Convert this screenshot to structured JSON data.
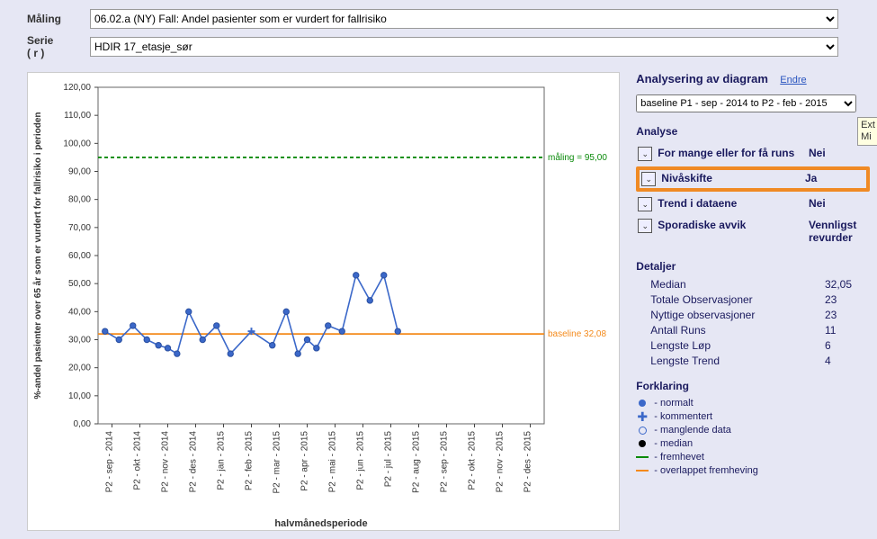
{
  "form": {
    "maling_label": "Måling",
    "maling_value": "06.02.a (NY) Fall: Andel pasienter som er vurdert for fallrisiko",
    "serie_label": "Serie\n( r )",
    "serie_value": "HDIR 17_etasje_sør"
  },
  "side": {
    "title": "Analysering av diagram",
    "endre": "Endre",
    "select_value": "baseline P1 - sep - 2014 to P2 - feb - 2015",
    "analyse_title": "Analyse",
    "rows": [
      {
        "label": "For mange eller for få runs",
        "value": "Nei"
      },
      {
        "label": "Nivåskifte",
        "value": "Ja"
      },
      {
        "label": "Trend i dataene",
        "value": "Nei"
      },
      {
        "label": "Sporadiske avvik",
        "value": "Vennligst revurder"
      }
    ],
    "details_title": "Detaljer",
    "details": [
      {
        "label": "Median",
        "value": "32,05"
      },
      {
        "label": "Totale Observasjoner",
        "value": "23"
      },
      {
        "label": "Nyttige observasjoner",
        "value": "23"
      },
      {
        "label": "Antall Runs",
        "value": "11"
      },
      {
        "label": "Lengste Løp",
        "value": "6"
      },
      {
        "label": "Lengste Trend",
        "value": "4"
      }
    ],
    "legend_title": "Forklaring",
    "legend": [
      {
        "sym": "dot",
        "text": "- normalt"
      },
      {
        "sym": "plus",
        "text": "- kommentert"
      },
      {
        "sym": "open",
        "text": "- manglende data"
      },
      {
        "sym": "black",
        "text": "- median"
      },
      {
        "sym": "green",
        "text": "- fremhevet"
      },
      {
        "sym": "orange",
        "text": "- overlappet fremheving"
      }
    ]
  },
  "tooltip": {
    "line1": "Ext",
    "line2": "Mi"
  },
  "chart_data": {
    "type": "line",
    "title": "",
    "ylabel": "%-andel pasienter over 65 år som er vurdert for fallrisiko i perioden",
    "xlabel": "halvmånedsperiode",
    "ylim": [
      0,
      120
    ],
    "yticks": [
      0,
      10,
      20,
      30,
      40,
      50,
      60,
      70,
      80,
      90,
      100,
      110,
      120
    ],
    "horiz_lines": [
      {
        "value": 95,
        "label": "måling = 95,00",
        "color": "#0a8a0a",
        "dash": "4,3"
      },
      {
        "value": 32.05,
        "label": "baseline 32,08",
        "color": "#f48a1b",
        "dash": ""
      }
    ],
    "categories": [
      "P2 - sep - 2014",
      "P2 - okt - 2014",
      "P2 - nov - 2014",
      "P2 - des - 2014",
      "P2 - jan - 2015",
      "P2 - feb - 2015",
      "P2 - mar - 2015",
      "P2 - apr - 2015",
      "P2 - mai - 2015",
      "P2 - jun - 2015",
      "P2 - jul - 2015",
      "P2 - aug - 2015",
      "P2 - sep - 2015",
      "P2 - okt - 2015",
      "P2 - nov - 2015",
      "P2 - des - 2015"
    ],
    "points": [
      {
        "i": 0,
        "sub": 0,
        "y": 33
      },
      {
        "i": 0,
        "sub": 1,
        "y": 30
      },
      {
        "i": 1,
        "sub": 0,
        "y": 35
      },
      {
        "i": 1,
        "sub": 1,
        "y": 30
      },
      {
        "i": 2,
        "sub": 0,
        "y": 28
      },
      {
        "i": 2,
        "sub": 1,
        "y": 27
      },
      {
        "i": 2,
        "sub": 2,
        "y": 25
      },
      {
        "i": 3,
        "sub": 0,
        "y": 40
      },
      {
        "i": 3,
        "sub": 1,
        "y": 30
      },
      {
        "i": 4,
        "sub": 0,
        "y": 35
      },
      {
        "i": 4,
        "sub": 1,
        "y": 25
      },
      {
        "i": 5,
        "sub": 0,
        "y": 33,
        "kommentert": true
      },
      {
        "i": 6,
        "sub": 0,
        "y": 28
      },
      {
        "i": 6,
        "sub": 1,
        "y": 40
      },
      {
        "i": 7,
        "sub": 0,
        "y": 25
      },
      {
        "i": 7,
        "sub": 1,
        "y": 30
      },
      {
        "i": 7,
        "sub": 2,
        "y": 27
      },
      {
        "i": 8,
        "sub": 0,
        "y": 35
      },
      {
        "i": 8,
        "sub": 1,
        "y": 33
      },
      {
        "i": 9,
        "sub": 0,
        "y": 53
      },
      {
        "i": 9,
        "sub": 1,
        "y": 44
      },
      {
        "i": 10,
        "sub": 0,
        "y": 53
      },
      {
        "i": 10,
        "sub": 1,
        "y": 33
      }
    ]
  }
}
